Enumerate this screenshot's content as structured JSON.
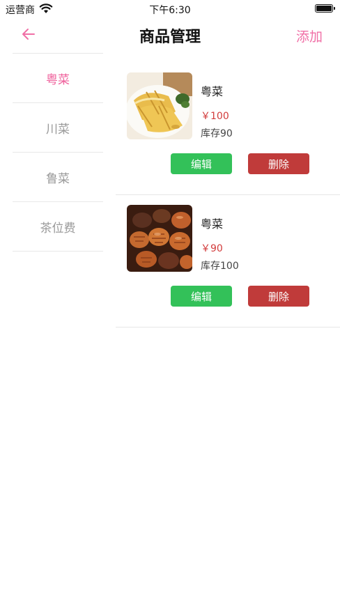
{
  "status_bar": {
    "carrier": "运营商",
    "time": "下午6:30",
    "wifi_icon": "wifi-icon",
    "battery_icon": "battery-icon",
    "battery_level": 1.0
  },
  "nav": {
    "back_icon": "arrow-left-icon",
    "title": "商品管理",
    "add_label": "添加",
    "accent_color": "#f06fa6"
  },
  "sidebar": {
    "items": [
      {
        "label": "粤菜",
        "active": true
      },
      {
        "label": "川菜",
        "active": false
      },
      {
        "label": "鲁菜",
        "active": false
      },
      {
        "label": "茶位费",
        "active": false
      }
    ]
  },
  "products": [
    {
      "name": "粤菜",
      "price": "￥100",
      "stock": "库存90",
      "image_icon": "chicken-dish-image",
      "edit_label": "编辑",
      "delete_label": "删除"
    },
    {
      "name": "粤菜",
      "price": "￥90",
      "stock": "库存100",
      "image_icon": "abalone-dish-image",
      "edit_label": "编辑",
      "delete_label": "删除"
    }
  ],
  "colors": {
    "edit_button": "#33c159",
    "delete_button": "#c03b3a",
    "price": "#d23c3c",
    "active_category": "#ef5e9a"
  }
}
